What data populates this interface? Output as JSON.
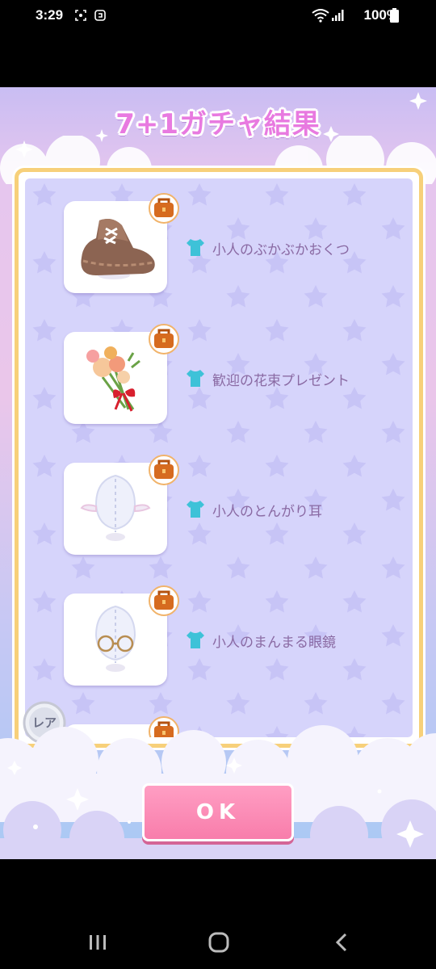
{
  "status_bar": {
    "time": "3:29",
    "battery": "100%",
    "icons": [
      "screenshot-icon",
      "app-notification-icon",
      "wifi-icon",
      "signal-icon",
      "battery-icon"
    ]
  },
  "header": {
    "title": "7+1ガチャ結果"
  },
  "results": {
    "items": [
      {
        "name": "小人のぶかぶかおくつ",
        "icon": "shoe-icon"
      },
      {
        "name": "歓迎の花束プレゼント",
        "icon": "flower-bouquet-icon"
      },
      {
        "name": "小人のとんがり耳",
        "icon": "pointy-ears-icon"
      },
      {
        "name": "小人のまんまる眼鏡",
        "icon": "round-glasses-icon"
      }
    ],
    "partial_item_badge": "レア"
  },
  "footer": {
    "ok_label": "OK"
  },
  "colors": {
    "title": "#e87ae0",
    "panel_bg": "#d6d4fb",
    "panel_border": "#f7d07a",
    "item_text": "#8a6aa3",
    "ok_button": "#f87dab"
  }
}
